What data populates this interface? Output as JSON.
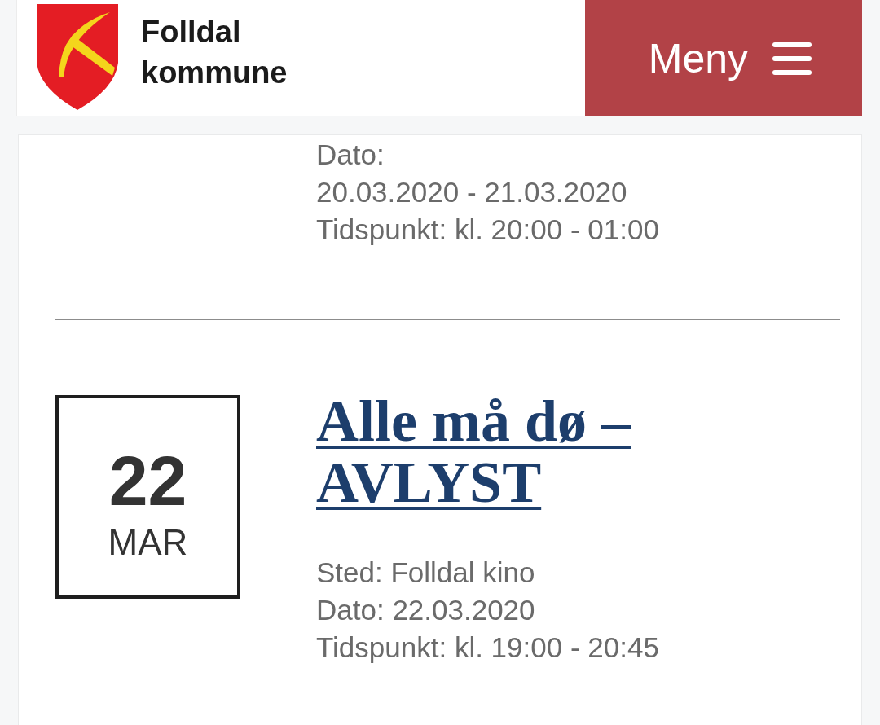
{
  "header": {
    "site_name": [
      "Folldal",
      "kommune"
    ],
    "menu_button": {
      "label": "Meny"
    }
  },
  "events": [
    {
      "details": [
        "Dato:",
        "20.03.2020 - 21.03.2020",
        "Tidspunkt: kl. 20:00 - 01:00"
      ]
    },
    {
      "day": "22",
      "month": "MAR",
      "title": "Alle må dø – AVLYST",
      "details": [
        "Sted: Folldal kino",
        "Dato: 22.03.2020",
        "Tidspunkt: kl. 19:00 - 20:45"
      ]
    }
  ]
}
